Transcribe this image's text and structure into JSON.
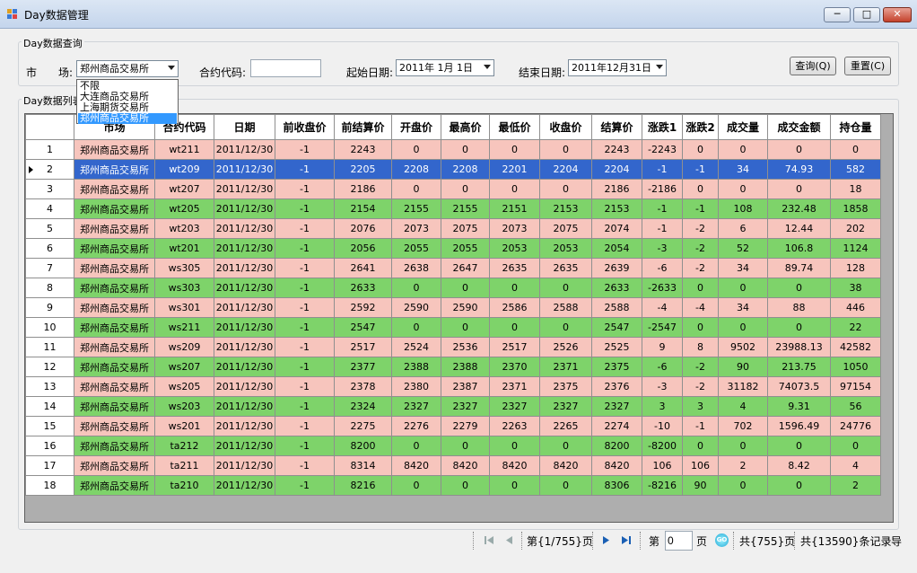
{
  "window": {
    "title": "Day数据管理",
    "min_label": "─",
    "max_label": "□",
    "close_label": "✕"
  },
  "query": {
    "legend": "Day数据查询",
    "market_label": "市　　场:",
    "market_value": "郑州商品交易所",
    "market_options": [
      "不限",
      "大连商品交易所",
      "上海期货交易所",
      "郑州商品交易所"
    ],
    "contract_label": "合约代码:",
    "contract_value": "",
    "start_label": "起始日期:",
    "start_value": "2011年 1月 1日",
    "end_label": "结束日期:",
    "end_value": "2011年12月31日",
    "query_button": "查询(Q)",
    "reset_button": "重置(C)"
  },
  "list": {
    "legend": "Day数据列表"
  },
  "table": {
    "columns": [
      "市场",
      "合约代码",
      "日期",
      "前收盘价",
      "前结算价",
      "开盘价",
      "最高价",
      "最低价",
      "收盘价",
      "结算价",
      "涨跌1",
      "涨跌2",
      "成交量",
      "成交金额",
      "持仓量"
    ],
    "rows": [
      {
        "n": "1",
        "c": [
          "郑州商品交易所",
          "wt211",
          "2011/12/30",
          "-1",
          "2243",
          "0",
          "0",
          "0",
          "0",
          "2243",
          "-2243",
          "0",
          "0",
          "0",
          "0"
        ]
      },
      {
        "n": "2",
        "c": [
          "郑州商品交易所",
          "wt209",
          "2011/12/30",
          "-1",
          "2205",
          "2208",
          "2208",
          "2201",
          "2204",
          "2204",
          "-1",
          "-1",
          "34",
          "74.93",
          "582"
        ]
      },
      {
        "n": "3",
        "c": [
          "郑州商品交易所",
          "wt207",
          "2011/12/30",
          "-1",
          "2186",
          "0",
          "0",
          "0",
          "0",
          "2186",
          "-2186",
          "0",
          "0",
          "0",
          "18"
        ]
      },
      {
        "n": "4",
        "c": [
          "郑州商品交易所",
          "wt205",
          "2011/12/30",
          "-1",
          "2154",
          "2155",
          "2155",
          "2151",
          "2153",
          "2153",
          "-1",
          "-1",
          "108",
          "232.48",
          "1858"
        ]
      },
      {
        "n": "5",
        "c": [
          "郑州商品交易所",
          "wt203",
          "2011/12/30",
          "-1",
          "2076",
          "2073",
          "2075",
          "2073",
          "2075",
          "2074",
          "-1",
          "-2",
          "6",
          "12.44",
          "202"
        ]
      },
      {
        "n": "6",
        "c": [
          "郑州商品交易所",
          "wt201",
          "2011/12/30",
          "-1",
          "2056",
          "2055",
          "2055",
          "2053",
          "2053",
          "2054",
          "-3",
          "-2",
          "52",
          "106.8",
          "1124"
        ]
      },
      {
        "n": "7",
        "c": [
          "郑州商品交易所",
          "ws305",
          "2011/12/30",
          "-1",
          "2641",
          "2638",
          "2647",
          "2635",
          "2635",
          "2639",
          "-6",
          "-2",
          "34",
          "89.74",
          "128"
        ]
      },
      {
        "n": "8",
        "c": [
          "郑州商品交易所",
          "ws303",
          "2011/12/30",
          "-1",
          "2633",
          "0",
          "0",
          "0",
          "0",
          "2633",
          "-2633",
          "0",
          "0",
          "0",
          "38"
        ]
      },
      {
        "n": "9",
        "c": [
          "郑州商品交易所",
          "ws301",
          "2011/12/30",
          "-1",
          "2592",
          "2590",
          "2590",
          "2586",
          "2588",
          "2588",
          "-4",
          "-4",
          "34",
          "88",
          "446"
        ]
      },
      {
        "n": "10",
        "c": [
          "郑州商品交易所",
          "ws211",
          "2011/12/30",
          "-1",
          "2547",
          "0",
          "0",
          "0",
          "0",
          "2547",
          "-2547",
          "0",
          "0",
          "0",
          "22"
        ]
      },
      {
        "n": "11",
        "c": [
          "郑州商品交易所",
          "ws209",
          "2011/12/30",
          "-1",
          "2517",
          "2524",
          "2536",
          "2517",
          "2526",
          "2525",
          "9",
          "8",
          "9502",
          "23988.13",
          "42582"
        ]
      },
      {
        "n": "12",
        "c": [
          "郑州商品交易所",
          "ws207",
          "2011/12/30",
          "-1",
          "2377",
          "2388",
          "2388",
          "2370",
          "2371",
          "2375",
          "-6",
          "-2",
          "90",
          "213.75",
          "1050"
        ]
      },
      {
        "n": "13",
        "c": [
          "郑州商品交易所",
          "ws205",
          "2011/12/30",
          "-1",
          "2378",
          "2380",
          "2387",
          "2371",
          "2375",
          "2376",
          "-3",
          "-2",
          "31182",
          "74073.5",
          "97154"
        ]
      },
      {
        "n": "14",
        "c": [
          "郑州商品交易所",
          "ws203",
          "2011/12/30",
          "-1",
          "2324",
          "2327",
          "2327",
          "2327",
          "2327",
          "2327",
          "3",
          "3",
          "4",
          "9.31",
          "56"
        ]
      },
      {
        "n": "15",
        "c": [
          "郑州商品交易所",
          "ws201",
          "2011/12/30",
          "-1",
          "2275",
          "2276",
          "2279",
          "2263",
          "2265",
          "2274",
          "-10",
          "-1",
          "702",
          "1596.49",
          "24776"
        ]
      },
      {
        "n": "16",
        "c": [
          "郑州商品交易所",
          "ta212",
          "2011/12/30",
          "-1",
          "8200",
          "0",
          "0",
          "0",
          "0",
          "8200",
          "-8200",
          "0",
          "0",
          "0",
          "0"
        ]
      },
      {
        "n": "17",
        "c": [
          "郑州商品交易所",
          "ta211",
          "2011/12/30",
          "-1",
          "8314",
          "8420",
          "8420",
          "8420",
          "8420",
          "8420",
          "106",
          "106",
          "2",
          "8.42",
          "4"
        ]
      },
      {
        "n": "18",
        "c": [
          "郑州商品交易所",
          "ta210",
          "2011/12/30",
          "-1",
          "8216",
          "0",
          "0",
          "0",
          "0",
          "8306",
          "-8216",
          "90",
          "0",
          "0",
          "2"
        ]
      }
    ],
    "selected_row": 2,
    "row_colors": {
      "pink": "#f7c5bd",
      "green": "#7ed36a",
      "selected": "#3366cc"
    }
  },
  "pager": {
    "current_text": "第{1/755}页",
    "page_label": "第",
    "page_input": "0",
    "page_unit": "页",
    "go_label": "GO",
    "total_pages": "共{755}页",
    "total_records": "共{13590}条记录",
    "export_label": "导"
  }
}
